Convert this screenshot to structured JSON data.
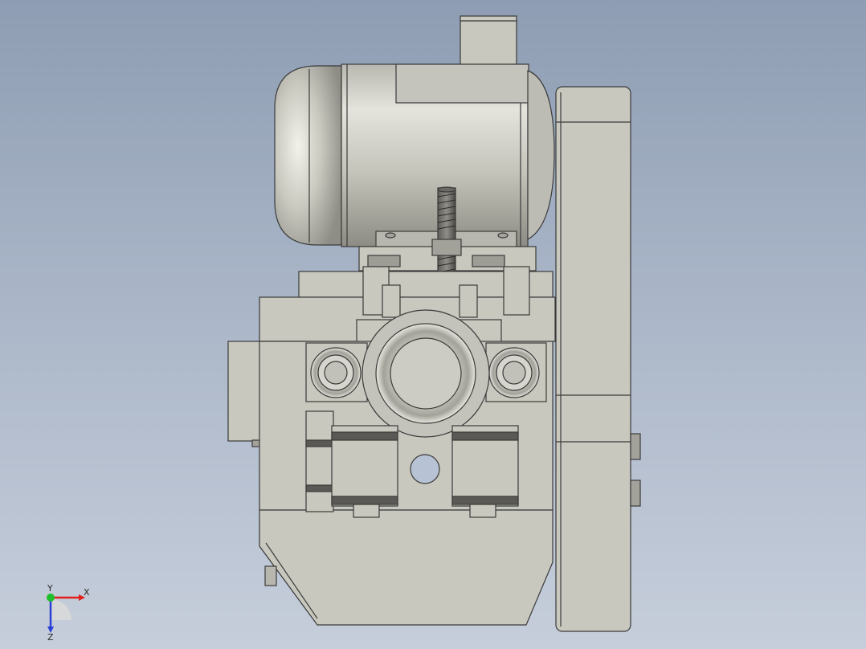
{
  "view": {
    "background_top": "#8e9db3",
    "background_bottom": "#c6cedb",
    "part_color": "#c9c8bf",
    "edge_color": "#3a3a3a"
  },
  "triad": {
    "x_label": "X",
    "y_label": "Y",
    "z_label": "Z",
    "x_color": "#e0201a",
    "y_color": "#1fbf2b",
    "z_color": "#2a3fd6"
  }
}
